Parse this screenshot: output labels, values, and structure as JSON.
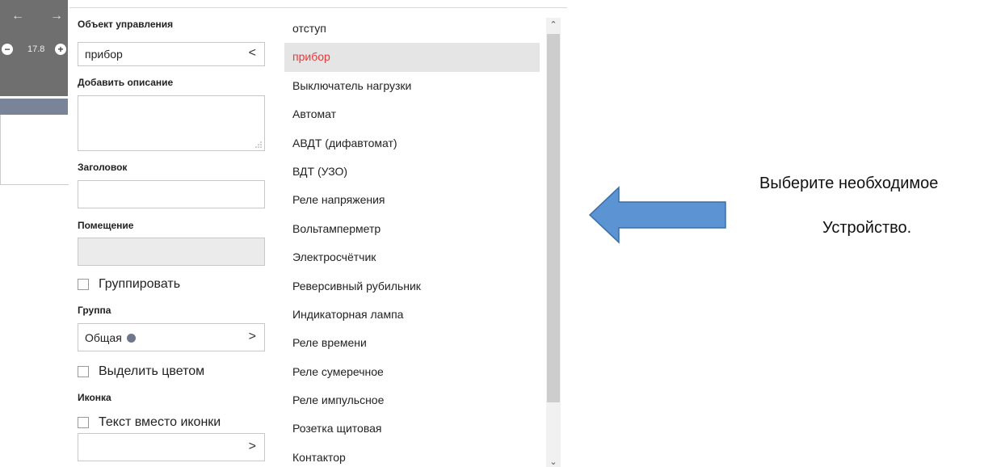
{
  "preview": {
    "back_arrow": "←",
    "forward_arrow": "→",
    "zoom_minus": "−",
    "zoom_value": "17.8",
    "zoom_plus": "+"
  },
  "form": {
    "object_label": "Объект управления",
    "object_value": "прибор",
    "object_chevron": "<",
    "description_label": "Добавить описание",
    "description_value": "",
    "title_label": "Заголовок",
    "title_value": "",
    "room_label": "Помещение",
    "room_value": "",
    "group_checkbox_label": "Группировать",
    "group_label": "Группа",
    "group_value": "Общая",
    "group_dot_color": "#6e7690",
    "group_chevron": ">",
    "highlight_checkbox_label": "Выделить цветом",
    "icon_label": "Иконка",
    "text_instead_icon_label": "Текст вместо иконки",
    "icon_value": "",
    "icon_chevron": ">"
  },
  "device_list": {
    "selected_index": 1,
    "items": [
      "отступ",
      "прибор",
      "Выключатель нагрузки",
      "Автомат",
      "АВДТ (дифавтомат)",
      "ВДТ (УЗО)",
      "Реле напряжения",
      "Вольтамперметр",
      "Электросчётчик",
      "Реверсивный рубильник",
      "Индикаторная лампа",
      "Реле времени",
      "Реле сумеречное",
      "Реле импульсное",
      "Розетка щитовая",
      "Контактор"
    ],
    "scroll_up": "⌃",
    "scroll_down": "⌄"
  },
  "annotation": {
    "line1": "Выберите необходимое",
    "line2": "Устройство.",
    "arrow_color": "#5b93d3",
    "arrow_border": "#3a6ea5"
  }
}
